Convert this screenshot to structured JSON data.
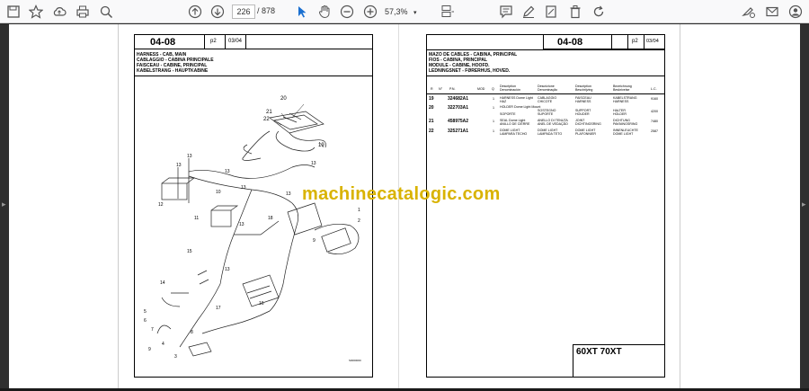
{
  "toolbar": {
    "page_current": "226",
    "page_total": "/ 878",
    "zoom": "57,3%",
    "icons": [
      "save-icon",
      "bookmark-star-icon",
      "cloud-upload-icon",
      "print-icon",
      "zoom-search-icon",
      "page-up-icon",
      "page-down-icon",
      "select-arrow-icon",
      "hand-icon",
      "zoom-out-icon",
      "zoom-in-icon",
      "page-layout-icon",
      "comment-icon",
      "pen-icon",
      "trash-icon",
      "rotate-icon",
      "sign-icon",
      "mail-icon",
      "account-icon"
    ]
  },
  "left_page": {
    "section": "04-08",
    "page_ref": "p2",
    "page_no": "03/04",
    "titles": [
      "HARNESS - CAB, MAIN",
      "CABLAGGIO - CABINA PRINCIPALE",
      "FAISCEAU - CABINE, PRINCIPAL",
      "KABELSTRANG - HAUPTKABINE"
    ],
    "callouts": [
      "20",
      "21",
      "22",
      "19",
      "13",
      "13",
      "13",
      "13",
      "13",
      "13",
      "12",
      "10",
      "11",
      "13",
      "13",
      "15",
      "14",
      "16",
      "18",
      "17",
      "1",
      "2",
      "3",
      "4",
      "5",
      "6",
      "7",
      "8",
      "9",
      "9"
    ],
    "figure_ref": "S0000000"
  },
  "right_page": {
    "section": "04-08",
    "page_ref": "p2",
    "page_no": "03/04",
    "titles": [
      "MAZO DE CABLES - CABINA, PRINCIPAL",
      "FIOS - CABINA, PRINCIPAL",
      "MODULE - CABINE, HOOFD.",
      "LEDNINGSNET - FØRERHUS, HOVED."
    ],
    "table_headers": [
      "R",
      "N°",
      "P.N.",
      "MOD",
      "Q",
      "Description Denominación",
      "Descrizione Denominação",
      "Description Beschrijving",
      "Bezeichnung Beskrivelse",
      "L.C."
    ],
    "rows": [
      {
        "ref": "19",
        "pn": "324682A1",
        "q": "1",
        "d1": "HARNESS Dome Light",
        "d1b": "HAZ",
        "d2": "CABLAGGIO",
        "d2b": "CHICOTE",
        "d3": "FAISCEAU",
        "d3b": "HARNESS",
        "d4": "KABELSTRANG",
        "d4b": "HARNESS",
        "lc": "9160"
      },
      {
        "ref": "20",
        "pn": "322703A1",
        "q": "1",
        "d1": "HOLDER Dome Light Mount",
        "d1b": "SOPORTE",
        "d2": "SOSTEGNO",
        "d2b": "SUPORTE",
        "d3": "SUPPORT",
        "d3b": "HOUDER",
        "d4": "HALTER",
        "d4b": "HOLDER",
        "lc": "4200"
      },
      {
        "ref": "21",
        "pn": "458975A2",
        "q": "1",
        "d1": "SEAL Dome Light",
        "d1b": "ANILLO DE CIERRE",
        "d2": "ANELLO DI TENUTA",
        "d2b": "ANEL DE VEDAÇÃO",
        "d3": "JOINT",
        "d3b": "DICHTINGSRING",
        "d4": "DICHTUNG",
        "d4b": "PAKNINGSRING",
        "lc": "7480"
      },
      {
        "ref": "22",
        "pn": "325271A1",
        "q": "1",
        "d1": "DOME LIGHT",
        "d1b": "LAMPARA TECHO",
        "d2": "DOME LIGHT",
        "d2b": "LAMPADA TETO",
        "d3": "DOME LIGHT",
        "d3b": "PLAFONNIER",
        "d4": "INNENLEUCHTE",
        "d4b": "DOME LIGHT",
        "lc": "2587"
      }
    ],
    "model": "60XT 70XT"
  },
  "watermark": "machinecatalogic.com"
}
